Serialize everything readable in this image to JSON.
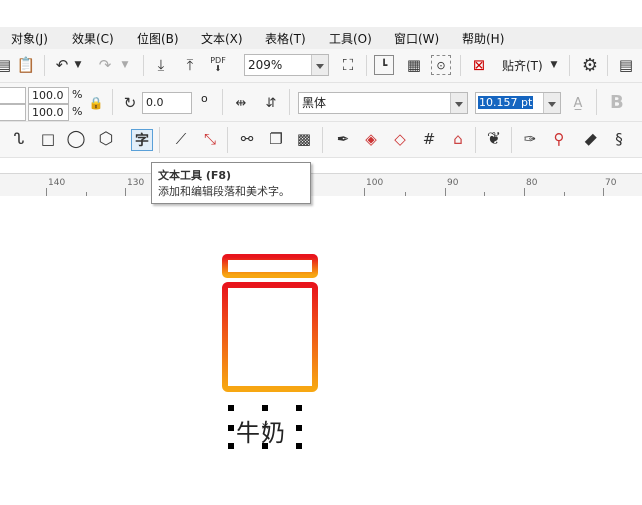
{
  "menu": [
    "对象(J)",
    "效果(C)",
    "位图(B)",
    "文本(X)",
    "表格(T)",
    "工具(O)",
    "窗口(W)",
    "帮助(H)"
  ],
  "toolbar1": {
    "zoom": "209%",
    "snap_label": "贴齐(T)",
    "pdf_label": "PDF"
  },
  "property_bar": {
    "scale_x": "100.0",
    "scale_y": "100.0",
    "percent": "%",
    "rotation": "0.0",
    "font_name": "黑体",
    "font_size": "10.157 pt",
    "bold_label": "B"
  },
  "ruler": {
    "labels": [
      "140",
      "130",
      "100",
      "90",
      "80",
      "70"
    ]
  },
  "tooltip": {
    "title": "文本工具 (F8)",
    "description": "添加和编辑段落和美术字。"
  },
  "canvas": {
    "text": "牛奶"
  },
  "colors": {
    "gradient_top": "#e8141c",
    "gradient_bottom": "#f7a712",
    "tool_active_border": "#5aa0d8"
  }
}
